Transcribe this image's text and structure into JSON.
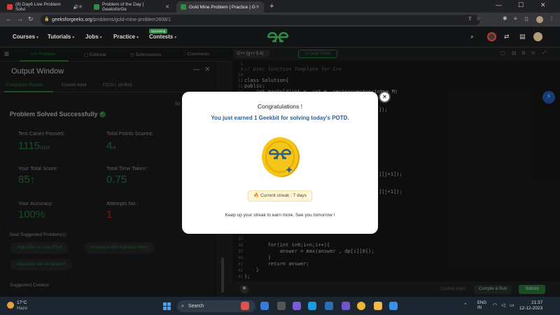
{
  "browser": {
    "tabs": [
      {
        "title": "(8) Day6 Live Problem Solvi",
        "favicon_color": "#e53935"
      },
      {
        "title": "Problem of the Day | GeeksforGe",
        "favicon_color": "#2f8d46"
      },
      {
        "title": "Gold Mine Problem | Practice | G",
        "favicon_color": "#2f8d46"
      }
    ],
    "url_host": "geeksforgeeks.org",
    "url_path": "/problems/gold-mine-problem2608/1"
  },
  "nav": {
    "items": [
      "Courses",
      "Tutorials",
      "Jobs",
      "Practice",
      "Contests"
    ],
    "upcoming_badge": "Upcoming"
  },
  "problem_tabs": [
    "Problem",
    "Editorial",
    "Submissions",
    "Comments"
  ],
  "output": {
    "title": "Output Window",
    "subtabs": [
      "Compilation Results",
      "Custom Input",
      "Y.O.G.I. (AI Bot)"
    ],
    "partial_label": "Su",
    "status": "Problem Solved Successfully",
    "stats": {
      "test_cases_label": "Test Cases Passed:",
      "test_cases_value": "1115",
      "test_cases_total": "/1115",
      "points_label": "Total Points Scored:",
      "points_value": "4",
      "points_total": "/4",
      "score_label": "Your Total Score:",
      "score_value": "85",
      "time_label": "Total Time Taken:",
      "time_value": "0.75",
      "accuracy_label": "Your Accuracy:",
      "accuracy_value": "100%",
      "attempts_label": "Attempts No.:",
      "attempts_value": "1"
    },
    "next_label": "Next Suggested Problem(s):",
    "next_problems": [
      "High Effort vs Low Effort",
      "Knapsack with Duplicate Items",
      "Adjacents are not allowed"
    ],
    "contest_label": "Suggested Contest:"
  },
  "editor": {
    "language": "C++ (g++ 5.4)",
    "timer_label": "Start Timer",
    "code_top": [
      {
        "n": "1",
        "t": ""
      },
      {
        "n": "9",
        "t": "// User function Template for C++"
      },
      {
        "n": "10",
        "t": ""
      },
      {
        "n": "11",
        "t": "class Solution{"
      },
      {
        "n": "12",
        "t": "public:"
      },
      {
        "n": "13",
        "t": "    int maxGold(int n, int m, vector<vector<int>> M)"
      }
    ],
    "code_right_1": "]);",
    "code_right_2": "][j+1]);",
    "code_right_3": "][j+1]);",
    "code_bottom": [
      {
        "n": "37",
        "t": ""
      },
      {
        "n": "38",
        "t": "        for(int i=0;i<n;i++){"
      },
      {
        "n": "39",
        "t": "            answer = max(answer , dp[i][0]);"
      },
      {
        "n": "40",
        "t": "        }"
      },
      {
        "n": "41",
        "t": "        return answer;"
      },
      {
        "n": "42",
        "t": "    }"
      },
      {
        "n": "43",
        "t": "};"
      },
      {
        "n": "44",
        "t": ""
      }
    ],
    "custom_input": "Custom Input",
    "compile_run": "Compile & Run",
    "submit": "Submit"
  },
  "modal": {
    "title": "Congratulations !",
    "subtitle": "You just earned 1 Geekbit for solving today's POTD.",
    "streak": "Current streak : 7 days",
    "footer": "Keep up your streak to earn more. See you tomorrow !",
    "close": "×"
  },
  "taskbar": {
    "temp": "17°C",
    "weather": "Haze",
    "search": "Search",
    "lang": "ENG",
    "region": "IN",
    "time": "21:37",
    "date": "12-12-2023"
  }
}
